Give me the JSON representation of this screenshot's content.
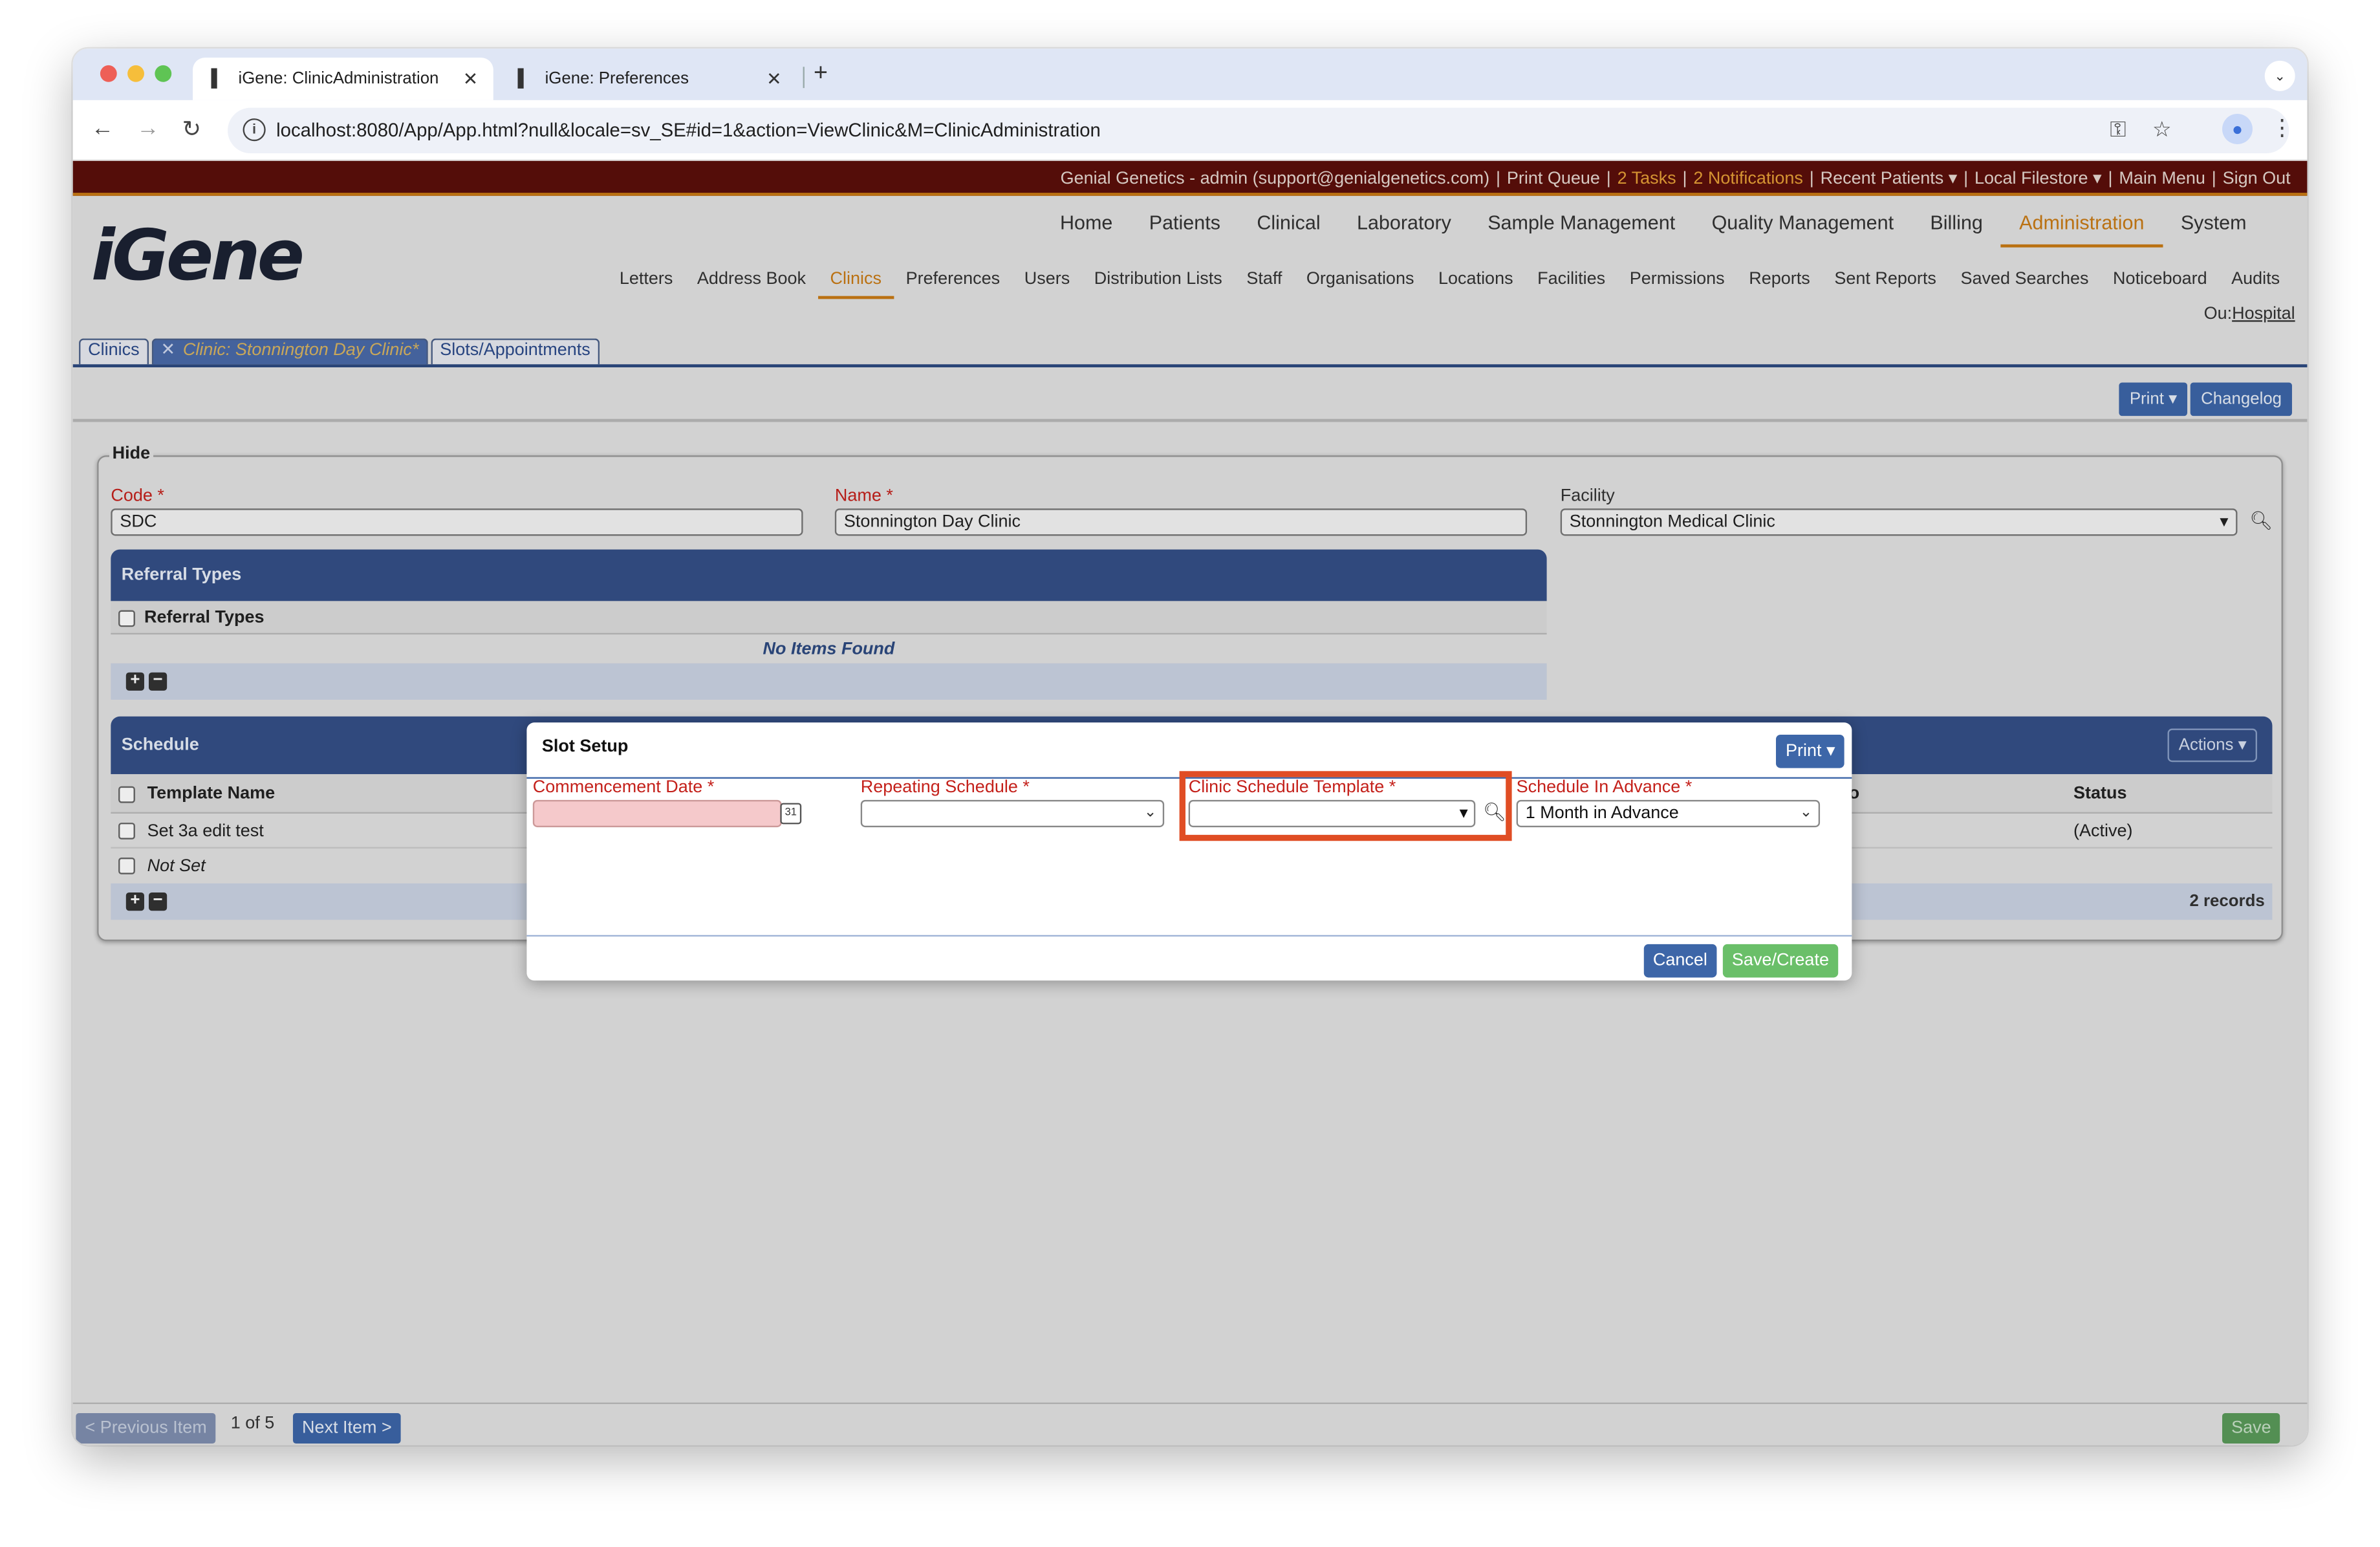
{
  "browser": {
    "tabs": [
      {
        "title": "iGene: ClinicAdministration",
        "active": true
      },
      {
        "title": "iGene: Preferences",
        "active": false
      }
    ],
    "url": "localhost:8080/App/App.html?null&locale=sv_SE#id=1&action=ViewClinic&M=ClinicAdministration"
  },
  "topbar": {
    "user": "Genial Genetics - admin (support@genialgenetics.com)",
    "print_queue": "Print Queue",
    "tasks": "2 Tasks",
    "notifications": "2 Notifications",
    "recent_patients": "Recent Patients ▾",
    "local_filestore": "Local Filestore ▾",
    "main_menu": "Main Menu",
    "sign_out": "Sign Out"
  },
  "logo": "iGene",
  "main_nav": [
    "Home",
    "Patients",
    "Clinical",
    "Laboratory",
    "Sample Management",
    "Quality Management",
    "Billing",
    "Administration",
    "System"
  ],
  "main_nav_active": "Administration",
  "sub_nav": [
    "Letters",
    "Address Book",
    "Clinics",
    "Preferences",
    "Users",
    "Distribution Lists",
    "Staff",
    "Organisations",
    "Locations",
    "Facilities",
    "Permissions",
    "Reports",
    "Sent Reports",
    "Saved Searches",
    "Noticeboard",
    "Audits"
  ],
  "sub_nav_active": "Clinics",
  "ou": {
    "label": "Ou:",
    "value": "Hospital"
  },
  "content_tabs": {
    "clinics": "Clinics",
    "current": "Clinic: Stonnington Day Clinic*",
    "close": "✕",
    "slots": "Slots/Appointments"
  },
  "action_buttons": {
    "print": "Print ▾",
    "changelog": "Changelog"
  },
  "form": {
    "legend": "Hide",
    "code_label": "Code *",
    "code_value": "SDC",
    "name_label": "Name *",
    "name_value": "Stonnington Day Clinic",
    "facility_label": "Facility",
    "facility_value": "Stonnington Medical Clinic",
    "facility_arrow": "▾"
  },
  "referral": {
    "title": "Referral Types",
    "column": "Referral Types",
    "empty": "No Items Found"
  },
  "schedule": {
    "title": "Schedule",
    "actions": "Actions ▾",
    "columns": {
      "template": "Template Name",
      "status": "Status",
      "partial": "o"
    },
    "rows": [
      {
        "name": "Set 3a edit test",
        "status": "(Active)"
      },
      {
        "name": "Not Set",
        "status": ""
      }
    ],
    "records": "2 records"
  },
  "bottom": {
    "prev": "< Previous Item",
    "pager": "1 of 5",
    "next": "Next Item >",
    "save": "Save"
  },
  "modal": {
    "title": "Slot Setup",
    "print": "Print ▾",
    "commencement_label": "Commencement Date *",
    "commencement_value": "",
    "calendar_day": "31",
    "repeating_label": "Repeating Schedule *",
    "repeating_value": "",
    "template_label": "Clinic Schedule Template *",
    "template_value": "",
    "template_arrow": "▾",
    "advance_label": "Schedule In Advance *",
    "advance_value": "1 Month in Advance",
    "cancel": "Cancel",
    "save_create": "Save/Create"
  },
  "colors": {
    "topbar": "#5b0e0a",
    "accent": "#c97a14",
    "section_header": "#344f87",
    "button_blue": "#3d66a8",
    "button_green": "#6abf69",
    "required": "#c4211b",
    "highlight": "#e04d24"
  }
}
